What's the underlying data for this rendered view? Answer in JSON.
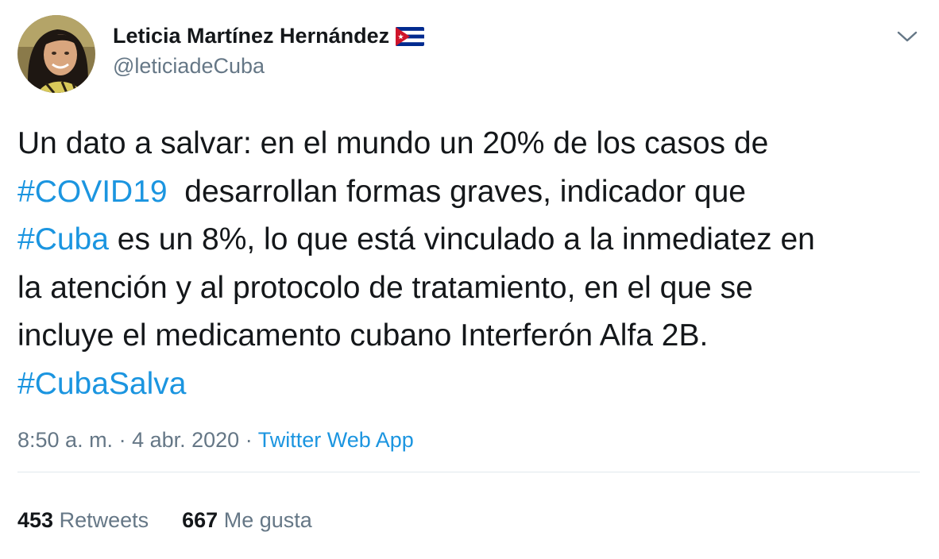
{
  "user": {
    "display_name": "Leticia Martínez Hernández",
    "handle": "@leticiadeCuba",
    "avatar_icon": "profile-photo",
    "flag_icon": "cuba-flag-emoji"
  },
  "tweet": {
    "lines": [
      [
        {
          "t": "Un dato a salvar: en el mundo un 20% de los casos de",
          "tag": false
        }
      ],
      [
        {
          "t": "#COVID19",
          "tag": true
        },
        {
          "t": "  desarrollan formas graves, indicador que",
          "tag": false
        }
      ],
      [
        {
          "t": "#Cuba",
          "tag": true
        },
        {
          "t": " es un 8%, lo que está vinculado a la inmediatez en",
          "tag": false
        }
      ],
      [
        {
          "t": "la atención y al protocolo de tratamiento, en el que se",
          "tag": false
        }
      ],
      [
        {
          "t": "incluye el medicamento cubano Interferón Alfa 2B.",
          "tag": false
        }
      ],
      [
        {
          "t": "#CubaSalva",
          "tag": true
        }
      ]
    ]
  },
  "meta": {
    "time": "8:50 a. m.",
    "separator": " · ",
    "date": "4 abr. 2020",
    "source": "Twitter Web App"
  },
  "stats": {
    "retweets_count": "453",
    "retweets_label": "Retweets",
    "likes_count": "667",
    "likes_label": "Me gusta"
  },
  "colors": {
    "link": "#1b95e0",
    "text": "#14171a",
    "secondary": "#657786",
    "divider": "#e1e8ed"
  },
  "icons": {
    "menu": "chevron-down-icon"
  }
}
